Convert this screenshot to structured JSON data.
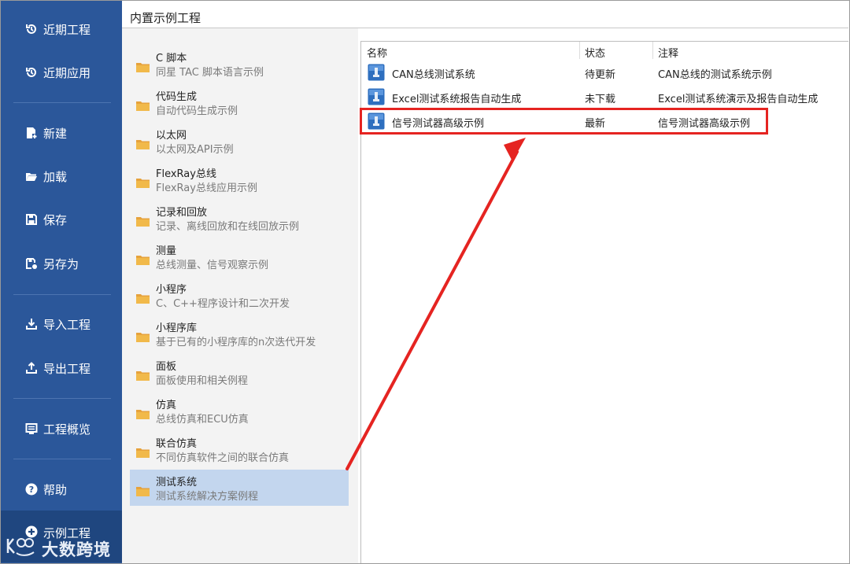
{
  "sidebar": {
    "items": [
      {
        "label": "近期工程",
        "icon": "history-icon"
      },
      {
        "label": "近期应用",
        "icon": "history-icon"
      },
      {
        "label": "新建",
        "icon": "new-file-icon"
      },
      {
        "label": "加载",
        "icon": "open-folder-icon"
      },
      {
        "label": "保存",
        "icon": "save-icon"
      },
      {
        "label": "另存为",
        "icon": "save-as-icon"
      },
      {
        "label": "导入工程",
        "icon": "import-icon"
      },
      {
        "label": "导出工程",
        "icon": "export-icon"
      },
      {
        "label": "工程概览",
        "icon": "overview-icon"
      },
      {
        "label": "帮助",
        "icon": "help-icon"
      },
      {
        "label": "示例工程",
        "icon": "add-circle-icon",
        "active": true
      }
    ],
    "accent_color": "#2b579a",
    "active_color": "#1f467f"
  },
  "watermark": {
    "text": "大数跨境"
  },
  "header": {
    "title": "内置示例工程"
  },
  "categories": [
    {
      "title": "C 脚本",
      "desc": "同星 TAC 脚本语言示例"
    },
    {
      "title": "代码生成",
      "desc": "自动代码生成示例"
    },
    {
      "title": "以太网",
      "desc": "以太网及API示例"
    },
    {
      "title": "FlexRay总线",
      "desc": "FlexRay总线应用示例"
    },
    {
      "title": "记录和回放",
      "desc": "记录、离线回放和在线回放示例"
    },
    {
      "title": "测量",
      "desc": "总线测量、信号观察示例"
    },
    {
      "title": "小程序",
      "desc": "C、C++程序设计和二次开发"
    },
    {
      "title": "小程序库",
      "desc": "基于已有的小程序库的n次迭代开发"
    },
    {
      "title": "面板",
      "desc": "面板使用和相关例程"
    },
    {
      "title": "仿真",
      "desc": "总线仿真和ECU仿真"
    },
    {
      "title": "联合仿真",
      "desc": "不同仿真软件之间的联合仿真"
    },
    {
      "title": "测试系统",
      "desc": "测试系统解决方案例程",
      "selected": true
    }
  ],
  "table": {
    "columns": [
      "名称",
      "状态",
      "注释"
    ],
    "rows": [
      {
        "name": "CAN总线测试系统",
        "status": "待更新",
        "note": "CAN总线的测试系统示例"
      },
      {
        "name": "Excel测试系统报告自动生成",
        "status": "未下载",
        "note": "Excel测试系统演示及报告自动生成"
      },
      {
        "name": "信号测试器高级示例",
        "status": "最新",
        "note": "信号测试器高级示例"
      }
    ]
  },
  "annotation": {
    "color": "#e52421"
  }
}
